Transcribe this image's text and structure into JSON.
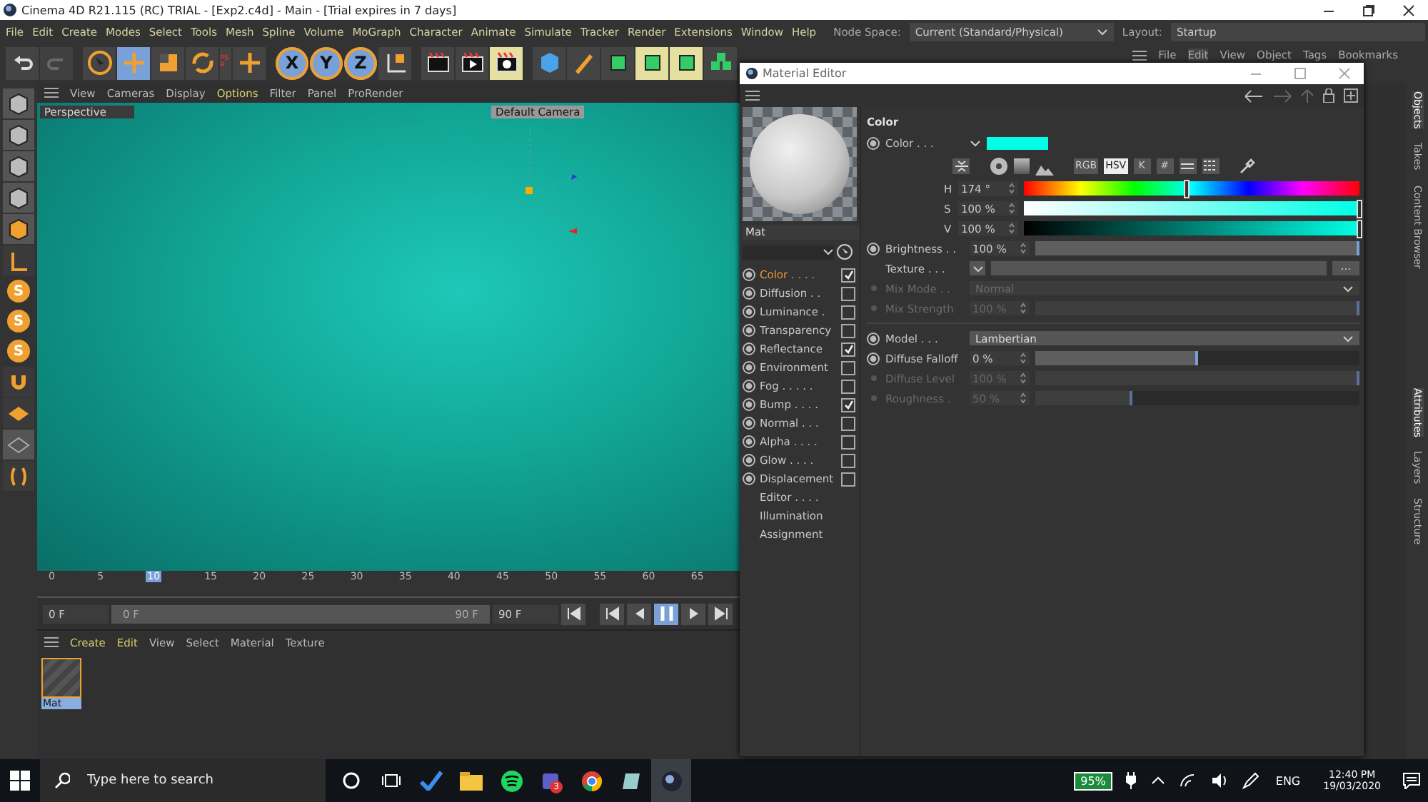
{
  "window": {
    "title": "Cinema 4D R21.115 (RC) TRIAL - [Exp2.c4d] - Main - [Trial expires in 7 days]"
  },
  "menu": [
    "File",
    "Edit",
    "Create",
    "Modes",
    "Select",
    "Tools",
    "Mesh",
    "Spline",
    "Volume",
    "MoGraph",
    "Character",
    "Animate",
    "Simulate",
    "Tracker",
    "Render",
    "Extensions",
    "Window",
    "Help"
  ],
  "node_space": {
    "label": "Node Space:",
    "value": "Current (Standard/Physical)"
  },
  "layout": {
    "label": "Layout:",
    "value": "Startup"
  },
  "toolbar": {
    "psr": "PSR",
    "axis_locks": [
      "X",
      "Y",
      "Z"
    ]
  },
  "left_tools": {
    "letters": [
      "S",
      "S",
      "S"
    ]
  },
  "viewport": {
    "menu": [
      {
        "label": "View",
        "selected": false
      },
      {
        "label": "Cameras",
        "selected": false
      },
      {
        "label": "Display",
        "selected": false
      },
      {
        "label": "Options",
        "selected": true
      },
      {
        "label": "Filter",
        "selected": false
      },
      {
        "label": "Panel",
        "selected": false
      },
      {
        "label": "ProRender",
        "selected": false
      }
    ],
    "name": "Perspective",
    "camera": "Default Camera"
  },
  "timeline": {
    "ticks": [
      {
        "label": "0",
        "selected": false
      },
      {
        "label": "5",
        "selected": false
      },
      {
        "label": "10",
        "selected": true
      },
      {
        "label": "15",
        "selected": false
      },
      {
        "label": "20",
        "selected": false
      },
      {
        "label": "25",
        "selected": false
      },
      {
        "label": "30",
        "selected": false
      },
      {
        "label": "35",
        "selected": false
      },
      {
        "label": "40",
        "selected": false
      },
      {
        "label": "45",
        "selected": false
      },
      {
        "label": "50",
        "selected": false
      },
      {
        "label": "55",
        "selected": false
      },
      {
        "label": "60",
        "selected": false
      },
      {
        "label": "65",
        "selected": false
      }
    ],
    "start": "0 F",
    "range_start": "0 F",
    "range_end": "90 F",
    "end": "90 F",
    "level": 1
  },
  "material_manager": {
    "menu": [
      {
        "label": "Create",
        "selected": true
      },
      {
        "label": "Edit",
        "selected": true
      },
      {
        "label": "View",
        "selected": false
      },
      {
        "label": "Select",
        "selected": false
      },
      {
        "label": "Material",
        "selected": false
      },
      {
        "label": "Texture",
        "selected": false
      }
    ],
    "materials": [
      {
        "name": "Mat",
        "selected": true
      }
    ]
  },
  "object_manager": {
    "menu": [
      {
        "label": "File",
        "selected": false
      },
      {
        "label": "Edit",
        "selected": true
      },
      {
        "label": "View",
        "selected": false
      },
      {
        "label": "Object",
        "selected": false
      },
      {
        "label": "Tags",
        "selected": false
      },
      {
        "label": "Bookmarks",
        "selected": false
      }
    ]
  },
  "side_tabs_top": [
    {
      "label": "Objects",
      "selected": true
    },
    {
      "label": "Takes",
      "selected": false
    },
    {
      "label": "Content Browser",
      "selected": false
    }
  ],
  "side_tabs_bottom": [
    {
      "label": "Attributes",
      "selected": true
    },
    {
      "label": "Layers",
      "selected": false
    },
    {
      "label": "Structure",
      "selected": false
    }
  ],
  "material_editor": {
    "title": "Material Editor",
    "material_name": "Mat",
    "channels": [
      {
        "kind": "channel",
        "label": "Color . . . .",
        "checked": true,
        "selected": true
      },
      {
        "kind": "channel",
        "label": "Diffusion . .",
        "checked": false,
        "selected": false
      },
      {
        "kind": "channel",
        "label": "Luminance .",
        "checked": false,
        "selected": false
      },
      {
        "kind": "channel",
        "label": "Transparency",
        "checked": false,
        "selected": false
      },
      {
        "kind": "channel",
        "label": "Reflectance",
        "checked": true,
        "selected": false
      },
      {
        "kind": "channel",
        "label": "Environment",
        "checked": false,
        "selected": false
      },
      {
        "kind": "channel",
        "label": "Fog . . . . .",
        "checked": false,
        "selected": false
      },
      {
        "kind": "channel",
        "label": "Bump . . . .",
        "checked": true,
        "selected": false
      },
      {
        "kind": "channel",
        "label": "Normal . . .",
        "checked": false,
        "selected": false
      },
      {
        "kind": "channel",
        "label": "Alpha . . . .",
        "checked": false,
        "selected": false
      },
      {
        "kind": "channel",
        "label": "Glow . . . .",
        "checked": false,
        "selected": false
      },
      {
        "kind": "channel",
        "label": "Displacement",
        "checked": false,
        "selected": false
      },
      {
        "kind": "page",
        "label": "Editor . . . .",
        "selected": false
      },
      {
        "kind": "page",
        "label": "Illumination",
        "selected": false
      },
      {
        "kind": "page",
        "label": "Assignment",
        "selected": false
      }
    ],
    "section": "Color",
    "color_label": "Color . . .",
    "color": "#00ffe6",
    "modes": [
      {
        "label": "RGB",
        "selected": false
      },
      {
        "label": "HSV",
        "selected": true
      },
      {
        "label": "K",
        "selected": false
      },
      {
        "label": "#",
        "selected": false
      }
    ],
    "hsv": [
      {
        "kind": "hue",
        "label": "H",
        "value": "174 °",
        "level": 0.483
      },
      {
        "kind": "sat",
        "label": "S",
        "value": "100 %",
        "level": 1
      },
      {
        "kind": "val",
        "label": "V",
        "value": "100 %",
        "level": 1
      }
    ],
    "params": [
      {
        "kind": "slider",
        "label": "Brightness . .",
        "value": "100 %",
        "level": 1,
        "disabled": false
      },
      {
        "kind": "texture",
        "label": "Texture . . .",
        "button": "...",
        "disabled": false
      },
      {
        "kind": "dropdown",
        "label": "Mix Mode . .",
        "value": "Normal",
        "disabled": true
      },
      {
        "kind": "slider",
        "label": "Mix Strength",
        "value": "100 %",
        "level": 1,
        "disabled": true
      },
      {
        "kind": "dropdown",
        "label": "Model . . .",
        "value": "Lambertian",
        "disabled": false
      },
      {
        "kind": "slider",
        "label": "Diffuse Falloff",
        "value": "0 %",
        "level": 0.5,
        "disabled": false
      },
      {
        "kind": "slider",
        "label": "Diffuse Level",
        "value": "100 %",
        "level": 1,
        "disabled": true
      },
      {
        "kind": "slider",
        "label": "Roughness .",
        "value": "50 %",
        "level": 0.3,
        "disabled": true
      }
    ]
  },
  "taskbar": {
    "search_placeholder": "Type here to search",
    "teams_badge": "3",
    "battery": "95%",
    "language": "ENG",
    "time": "12:40 PM",
    "date": "19/03/2020"
  }
}
